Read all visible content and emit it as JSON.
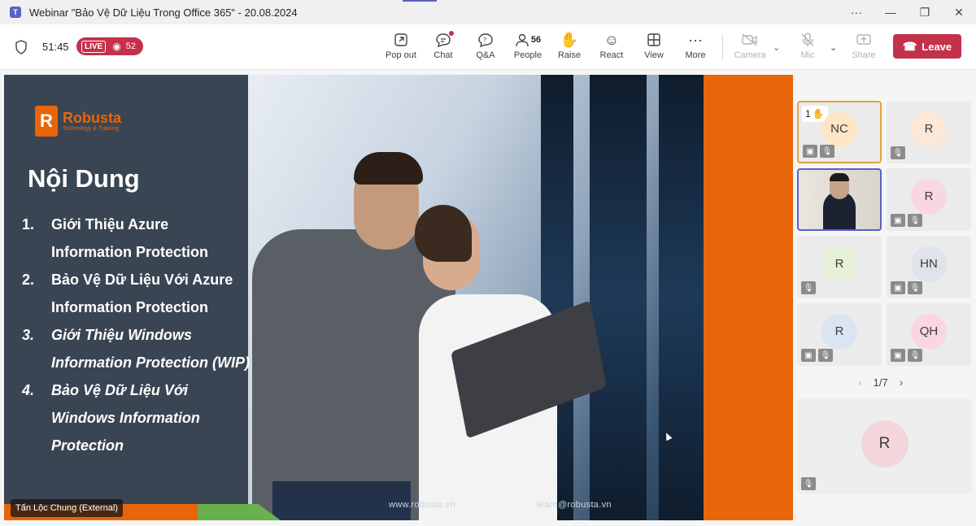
{
  "window": {
    "title": "Webinar \"Bảo Vệ Dữ Liệu Trong Office 365\" - 20.08.2024",
    "controls": [
      "···",
      "—",
      "❐",
      "✕"
    ]
  },
  "meeting": {
    "elapsed": "51:45",
    "live_label": "LIVE",
    "viewers": "52"
  },
  "toolbar": {
    "popout": "Pop out",
    "chat": "Chat",
    "qa": "Q&A",
    "people": "People",
    "people_count": "56",
    "raise": "Raise",
    "react": "React",
    "view": "View",
    "more": "More",
    "camera": "Camera",
    "mic": "Mic",
    "share": "Share",
    "leave": "Leave"
  },
  "slide": {
    "logo_name": "Robusta",
    "logo_tagline": "Technology & Training",
    "heading": "Nội Dung",
    "items": [
      {
        "num": "1.",
        "lines": [
          "Giới Thiệu Azure",
          "Information Protection"
        ]
      },
      {
        "num": "2.",
        "lines": [
          "Bảo Vệ Dữ Liệu Với Azure",
          "Information Protection"
        ]
      },
      {
        "num": "3.",
        "lines": [
          "Giới Thiệu Windows",
          "Information Protection (WIP)"
        ]
      },
      {
        "num": "4.",
        "lines": [
          "Bảo Vệ Dữ Liệu Với",
          "Windows Information",
          "Protection"
        ]
      }
    ],
    "footer_site": "www.robusta.vn",
    "footer_email": "learn@robusta.vn"
  },
  "presenter_tag": "Tấn Lộc Chung (External)",
  "participants": {
    "tiles": [
      {
        "initials": "NC",
        "color": "#fbe7c6",
        "raised": "1"
      },
      {
        "initials": "R",
        "color": "#fde7d6"
      },
      {
        "initials": "",
        "video": true
      },
      {
        "initials": "R",
        "color": "#f9d6e1"
      },
      {
        "initials": "R",
        "color": "#e7f0d9"
      },
      {
        "initials": "HN",
        "color": "#dfe4ea"
      },
      {
        "initials": "R",
        "color": "#dbe4f2"
      },
      {
        "initials": "QH",
        "color": "#f9d6e1"
      }
    ],
    "pager": "1/7",
    "featured_initials": "R",
    "featured_color": "#f3d6dc"
  }
}
